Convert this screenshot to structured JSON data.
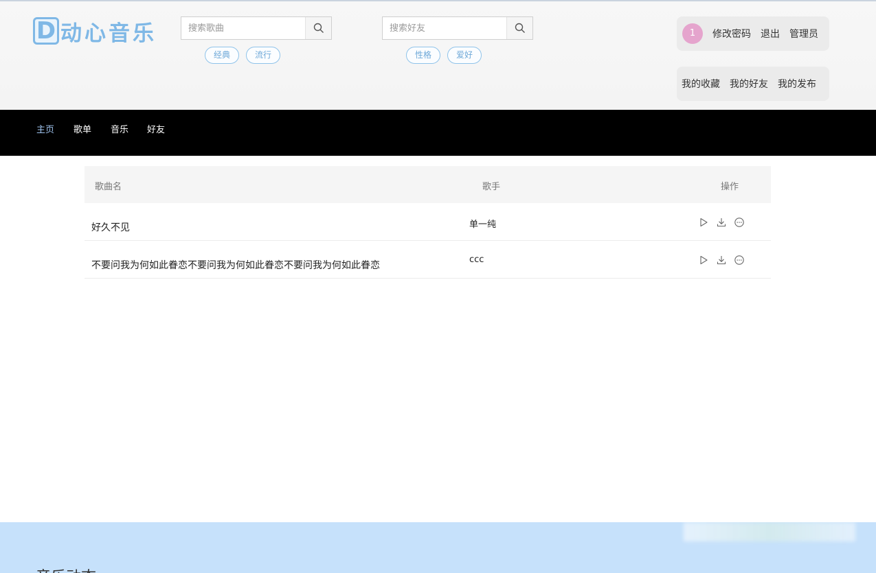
{
  "logo": {
    "letter": "D",
    "text": "动心音乐"
  },
  "search_song": {
    "placeholder": "搜索歌曲",
    "tags": [
      "经典",
      "流行"
    ]
  },
  "search_friend": {
    "placeholder": "搜索好友",
    "tags": [
      "性格",
      "爱好"
    ]
  },
  "user_panel": {
    "badge": "1",
    "links": [
      "修改密码",
      "退出",
      "管理员"
    ]
  },
  "my_panel": {
    "links": [
      "我的收藏",
      "我的好友",
      "我的发布"
    ]
  },
  "nav": {
    "items": [
      "主页",
      "歌单",
      "音乐",
      "好友"
    ],
    "active": 0
  },
  "table": {
    "headers": {
      "name": "歌曲名",
      "singer": "歌手",
      "ops": "操作"
    },
    "rows": [
      {
        "name": "好久不见",
        "singer": "单一纯"
      },
      {
        "name": "不要问我为何如此眷恋不要问我为何如此眷恋不要问我为何如此眷恋",
        "singer": "ccc"
      }
    ]
  },
  "footer": {
    "title": "音乐动态"
  },
  "colors": {
    "accent": "#7fb8e6",
    "nav_bg": "#000000",
    "nav_active": "#9fc3ee",
    "badge": "#e5a4cd",
    "footer_bg": "#c6e1fb"
  },
  "icons": {
    "search": "search-icon",
    "play": "play-icon",
    "download": "download-icon",
    "more": "more-icon"
  }
}
